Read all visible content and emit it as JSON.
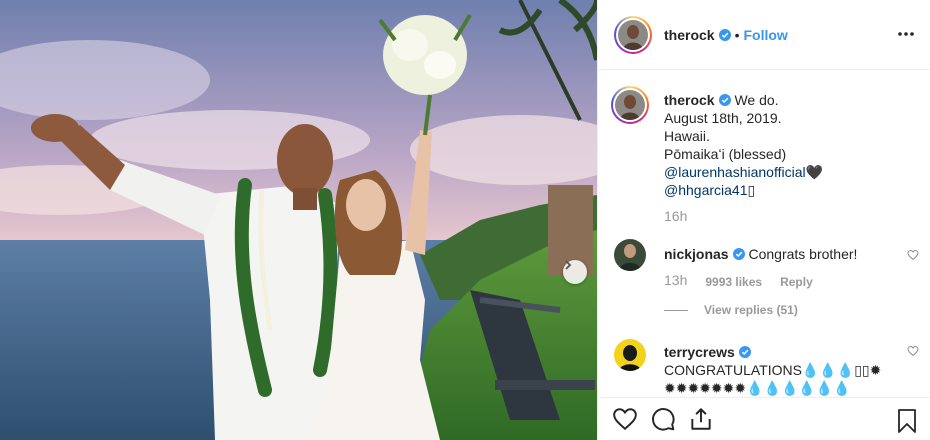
{
  "header": {
    "username": "therock",
    "separator": "•",
    "follow_label": "Follow"
  },
  "caption": {
    "username": "therock",
    "lines": [
      "We do.",
      "August 18th, 2019.",
      "Hawaii.",
      "Pōmaikaʻi (blessed)"
    ],
    "mention1": "@laurenhashianofficial",
    "heart": "🖤",
    "mention2": "@hhgarcia41",
    "trailing": "▯",
    "time": "16h"
  },
  "comments": [
    {
      "username": "nickjonas",
      "text": "Congrats brother!",
      "time": "13h",
      "likes": "9993 likes",
      "reply_label": "Reply",
      "view_replies": "View replies (51)"
    },
    {
      "username": "terrycrews",
      "text": "CONGRATULATIONS💧💧💧▯▯✹",
      "text2": "✹✹✹✹✹✹✹💧💧💧💧💧💧"
    }
  ],
  "colors": {
    "link": "#3897f0",
    "mention": "#003569",
    "muted": "#999999",
    "verified": "#3897f0"
  },
  "icons": [
    "verified-badge-icon",
    "more-options-icon",
    "chevron-right-icon",
    "heart-icon",
    "comment-icon",
    "share-icon",
    "bookmark-icon"
  ]
}
